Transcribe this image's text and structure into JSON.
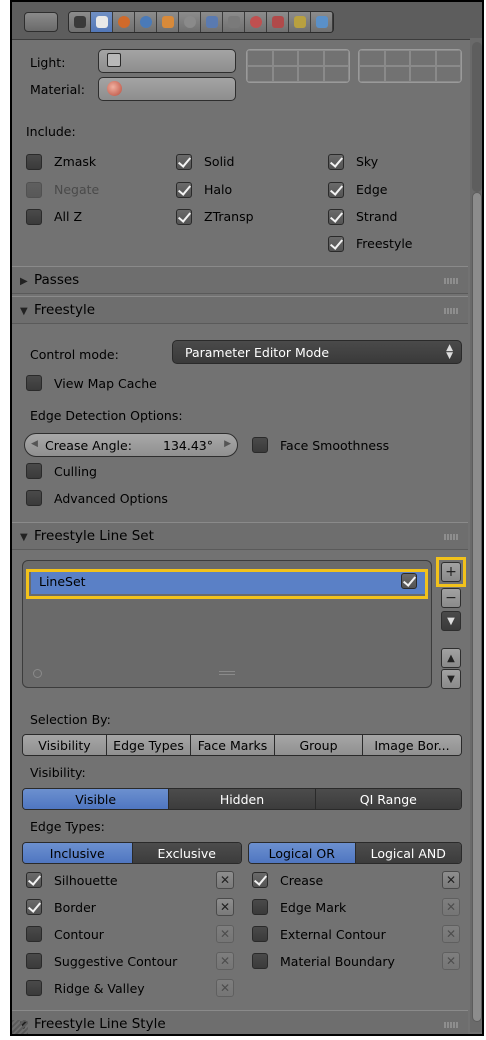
{
  "render": {
    "light_label": "Light:",
    "material_label": "Material:",
    "include_label": "Include:",
    "include": [
      {
        "label": "Zmask",
        "checked": false,
        "enabled": true
      },
      {
        "label": "Negate",
        "checked": false,
        "enabled": false
      },
      {
        "label": "All Z",
        "checked": false,
        "enabled": true
      },
      {
        "label": "Solid",
        "checked": true,
        "enabled": true
      },
      {
        "label": "Halo",
        "checked": true,
        "enabled": true
      },
      {
        "label": "ZTransp",
        "checked": true,
        "enabled": true
      },
      {
        "label": "Sky",
        "checked": true,
        "enabled": true
      },
      {
        "label": "Edge",
        "checked": true,
        "enabled": true
      },
      {
        "label": "Strand",
        "checked": true,
        "enabled": true
      },
      {
        "label": "Freestyle",
        "checked": true,
        "enabled": true
      }
    ]
  },
  "panels": {
    "passes": "Passes",
    "freestyle": "Freestyle",
    "lineset": "Freestyle Line Set",
    "linestyle": "Freestyle Line Style"
  },
  "freestyle": {
    "control_mode_label": "Control mode:",
    "control_mode_value": "Parameter Editor Mode",
    "view_map_cache": "View Map Cache",
    "edge_detection_label": "Edge Detection Options:",
    "crease_angle_label": "Crease Angle:",
    "crease_angle_value": "134.43°",
    "face_smoothness": "Face Smoothness",
    "culling": "Culling",
    "advanced_options": "Advanced Options"
  },
  "lineset": {
    "items": [
      {
        "name": "LineSet",
        "checked": true
      }
    ],
    "selection_by_label": "Selection By:",
    "selection_by": [
      "Visibility",
      "Edge Types",
      "Face Marks",
      "Group",
      "Image Bor..."
    ],
    "visibility_label": "Visibility:",
    "visibility_options": [
      "Visible",
      "Hidden",
      "QI Range"
    ],
    "visibility_selected": "Visible",
    "edge_types_label": "Edge Types:",
    "edge_mode": [
      "Inclusive",
      "Exclusive"
    ],
    "edge_mode_selected": "Inclusive",
    "logic_mode": [
      "Logical OR",
      "Logical AND"
    ],
    "logic_mode_selected": "Logical OR",
    "edge_types_left": [
      {
        "label": "Silhouette",
        "checked": true
      },
      {
        "label": "Border",
        "checked": true
      },
      {
        "label": "Contour",
        "checked": false
      },
      {
        "label": "Suggestive Contour",
        "checked": false
      },
      {
        "label": "Ridge & Valley",
        "checked": false
      }
    ],
    "edge_types_right": [
      {
        "label": "Crease",
        "checked": true
      },
      {
        "label": "Edge Mark",
        "checked": false
      },
      {
        "label": "External Contour",
        "checked": false
      },
      {
        "label": "Material Boundary",
        "checked": false
      }
    ]
  },
  "colors": {
    "highlight": "#f2c21b",
    "selection_blue": "#5a80c6"
  }
}
